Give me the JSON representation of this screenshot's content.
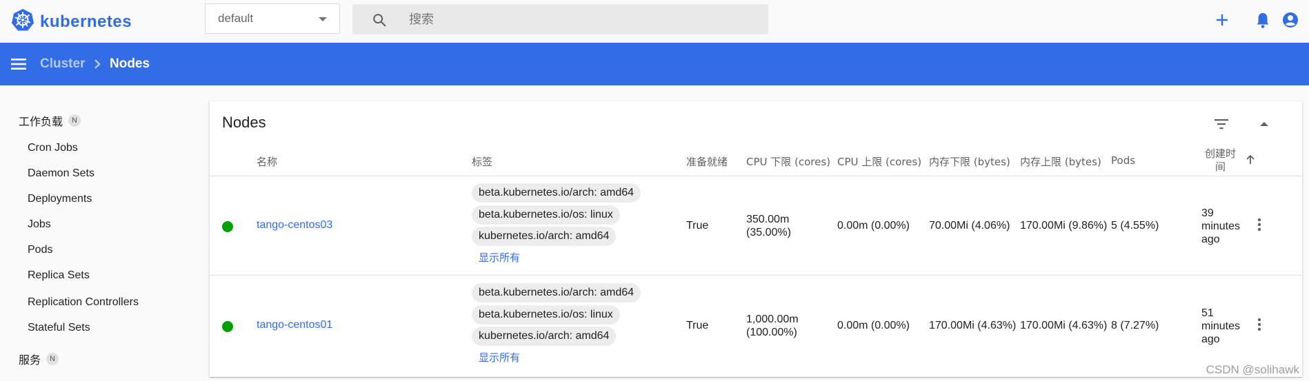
{
  "header": {
    "logo_text": "kubernetes",
    "namespace": "default",
    "search_placeholder": "搜索"
  },
  "toolbar": {
    "breadcrumb_parent": "Cluster",
    "breadcrumb_current": "Nodes"
  },
  "sidebar": {
    "groups": [
      {
        "label": "工作负载",
        "badge": "N",
        "items": [
          "Cron Jobs",
          "Daemon Sets",
          "Deployments",
          "Jobs",
          "Pods",
          "Replica Sets",
          "Replication Controllers",
          "Stateful Sets"
        ]
      },
      {
        "label": "服务",
        "badge": "N",
        "items": []
      }
    ]
  },
  "card": {
    "title": "Nodes",
    "columns": {
      "name": "名称",
      "labels": "标签",
      "ready": "准备就绪",
      "cpu_requests": "CPU 下限 (cores)",
      "cpu_limits": "CPU 上限 (cores)",
      "mem_requests": "内存下限 (bytes)",
      "mem_limits": "内存上限 (bytes)",
      "pods": "Pods",
      "created_line1": "创建时",
      "created_line2": "间"
    },
    "show_all_label": "显示所有",
    "rows": [
      {
        "name": "tango-centos03",
        "labels": [
          "beta.kubernetes.io/arch: amd64",
          "beta.kubernetes.io/os: linux",
          "kubernetes.io/arch: amd64"
        ],
        "ready": "True",
        "cpu_requests_1": "350.00m",
        "cpu_requests_2": "(35.00%)",
        "cpu_limits": "0.00m (0.00%)",
        "mem_requests": "70.00Mi (4.06%)",
        "mem_limits": "170.00Mi (9.86%)",
        "pods": "5 (4.55%)",
        "created_1": "39",
        "created_2": "minutes",
        "created_3": "ago"
      },
      {
        "name": "tango-centos01",
        "labels": [
          "beta.kubernetes.io/arch: amd64",
          "beta.kubernetes.io/os: linux",
          "kubernetes.io/arch: amd64"
        ],
        "ready": "True",
        "cpu_requests_1": "1,000.00m",
        "cpu_requests_2": "(100.00%)",
        "cpu_limits": "0.00m (0.00%)",
        "mem_requests": "170.00Mi (4.63%)",
        "mem_limits": "170.00Mi (4.63%)",
        "pods": "8 (7.27%)",
        "created_1": "51",
        "created_2": "minutes",
        "created_3": "ago"
      }
    ]
  },
  "watermark": "CSDN @solihawk",
  "colors": {
    "brand": "#326ce5",
    "toolbar": "#326de6",
    "status_ready": "#00a000"
  },
  "icons": {
    "logo": "kubernetes-helm-icon",
    "search": "search-icon",
    "add": "plus-icon",
    "notifications": "bell-icon",
    "account": "account-circle-icon",
    "menu": "hamburger-menu-icon",
    "filter": "filter-icon",
    "collapse": "chevron-up-icon",
    "sort": "arrow-up-icon",
    "more": "more-vert-icon"
  }
}
